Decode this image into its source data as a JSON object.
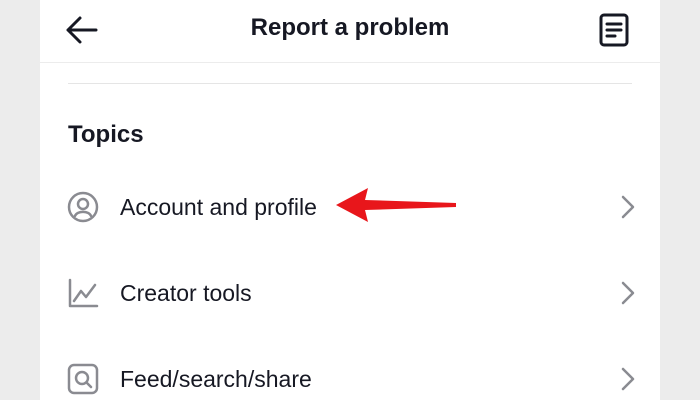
{
  "header": {
    "title": "Report a problem",
    "back_icon": "arrow-left-icon",
    "history_icon": "document-icon"
  },
  "topics": {
    "heading": "Topics",
    "items": [
      {
        "label": "Account and profile",
        "icon": "user-circle-icon"
      },
      {
        "label": "Creator tools",
        "icon": "line-chart-icon"
      },
      {
        "label": "Feed/search/share",
        "icon": "search-square-icon"
      }
    ]
  },
  "annotation": {
    "arrow_color": "#e8161b",
    "points_to": "Account and profile"
  },
  "colors": {
    "text": "#161823",
    "icon_gray": "#8a8b91",
    "background": "#ffffff"
  }
}
